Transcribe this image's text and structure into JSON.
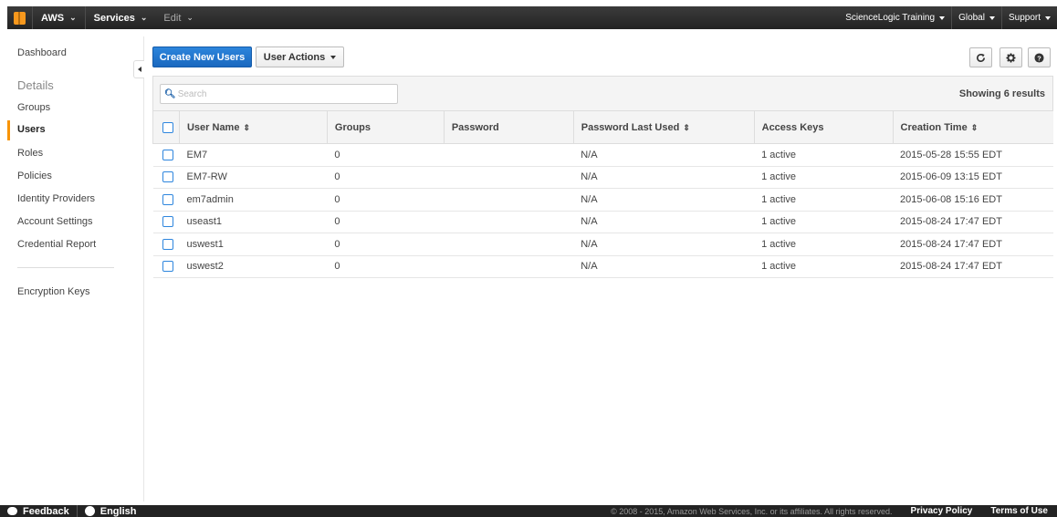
{
  "topbar": {
    "aws": "AWS",
    "services": "Services",
    "edit": "Edit",
    "account": "ScienceLogic Training",
    "region": "Global",
    "support": "Support"
  },
  "sidebar": {
    "dashboard": "Dashboard",
    "details_heading": "Details",
    "items": [
      {
        "label": "Groups"
      },
      {
        "label": "Users",
        "active": true
      },
      {
        "label": "Roles"
      },
      {
        "label": "Policies"
      },
      {
        "label": "Identity Providers"
      },
      {
        "label": "Account Settings"
      },
      {
        "label": "Credential Report"
      }
    ],
    "encryption": "Encryption Keys"
  },
  "toolbar": {
    "create": "Create New Users",
    "actions": "User Actions",
    "refresh_icon": "refresh-icon",
    "settings_icon": "gear-icon",
    "help_icon": "help-icon"
  },
  "search": {
    "placeholder": "Search",
    "results": "Showing 6 results"
  },
  "table": {
    "headers": [
      "User Name",
      "Groups",
      "Password",
      "Password Last Used",
      "Access Keys",
      "Creation Time"
    ],
    "rows": [
      {
        "name": "EM7",
        "groups": "0",
        "password": "",
        "last_used": "N/A",
        "keys": "1 active",
        "created": "2015-05-28 15:55 EDT"
      },
      {
        "name": "EM7-RW",
        "groups": "0",
        "password": "",
        "last_used": "N/A",
        "keys": "1 active",
        "created": "2015-06-09 13:15 EDT"
      },
      {
        "name": "em7admin",
        "groups": "0",
        "password": "",
        "last_used": "N/A",
        "keys": "1 active",
        "created": "2015-06-08 15:16 EDT"
      },
      {
        "name": "useast1",
        "groups": "0",
        "password": "",
        "last_used": "N/A",
        "keys": "1 active",
        "created": "2015-08-24 17:47 EDT"
      },
      {
        "name": "uswest1",
        "groups": "0",
        "password": "",
        "last_used": "N/A",
        "keys": "1 active",
        "created": "2015-08-24 17:47 EDT"
      },
      {
        "name": "uswest2",
        "groups": "0",
        "password": "",
        "last_used": "N/A",
        "keys": "1 active",
        "created": "2015-08-24 17:47 EDT"
      }
    ]
  },
  "footer": {
    "feedback": "Feedback",
    "language": "English",
    "copyright": "© 2008 - 2015, Amazon Web Services, Inc. or its affiliates. All rights reserved.",
    "privacy": "Privacy Policy",
    "terms": "Terms of Use"
  },
  "colors": {
    "primary_button": "#1f73c8",
    "active_marker": "#f89406",
    "topbar": "#232323",
    "aws_logo": "#f7981d"
  }
}
